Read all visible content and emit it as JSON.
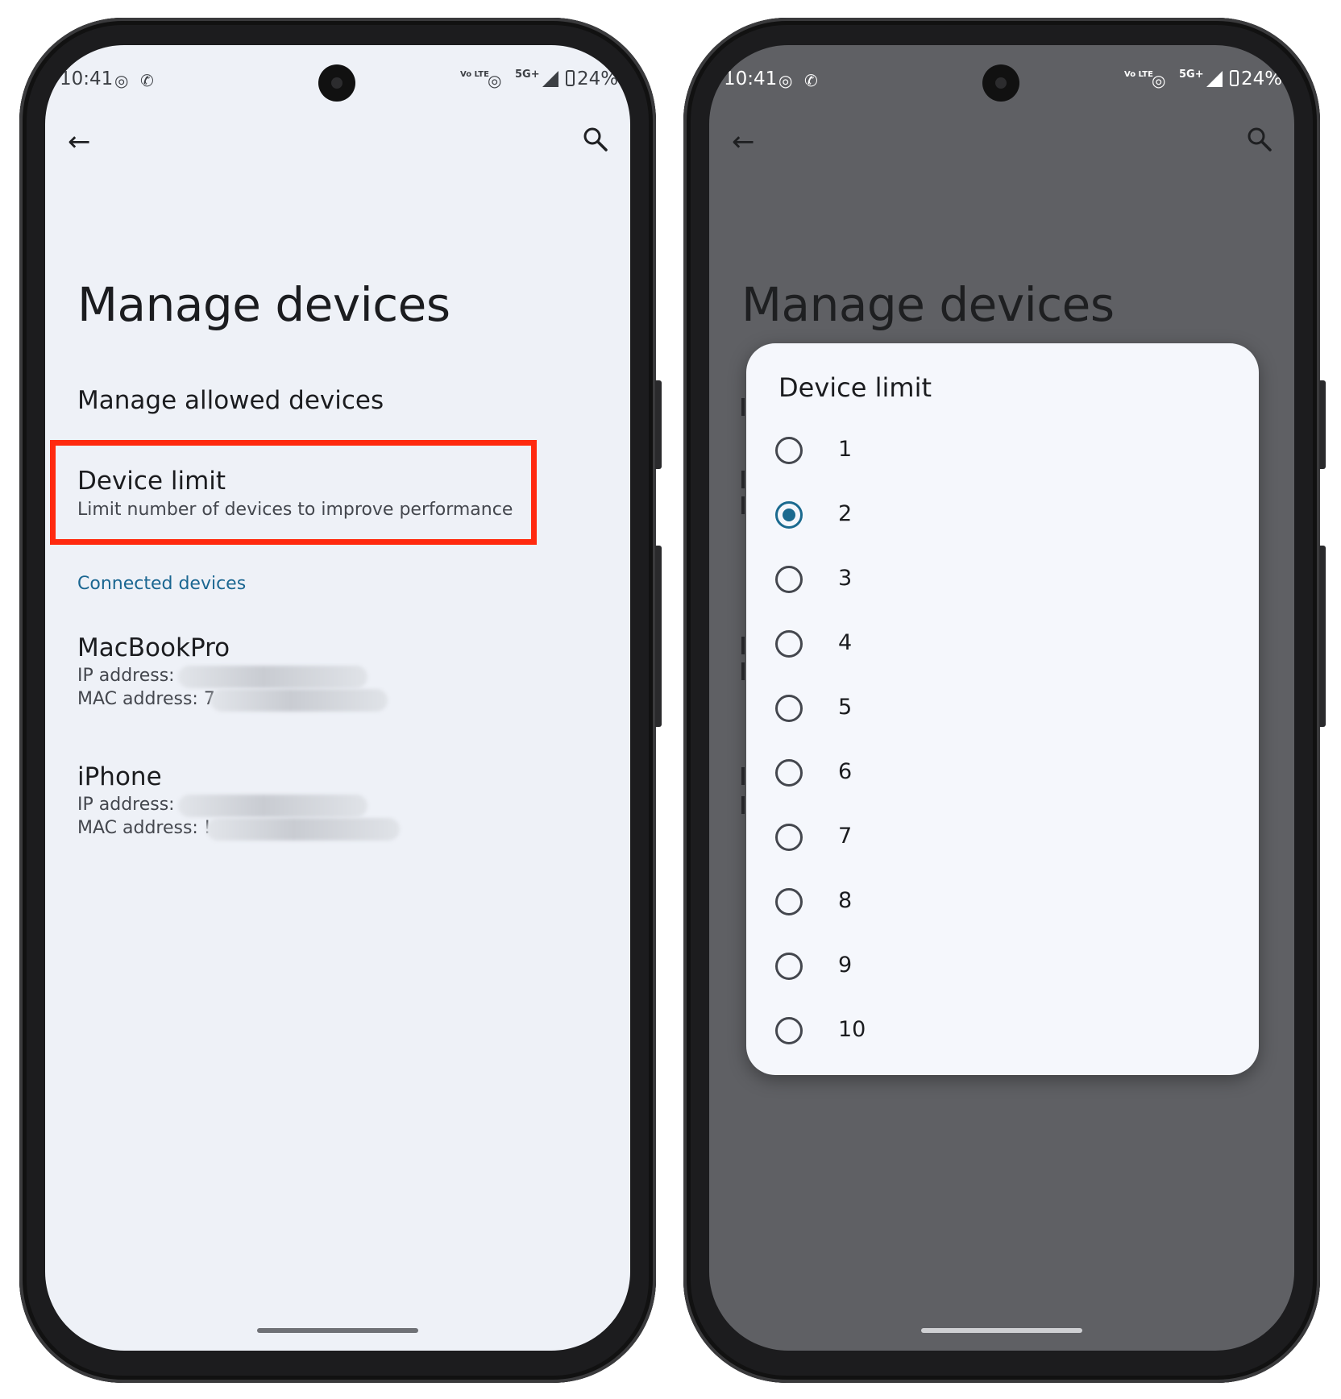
{
  "status": {
    "time": "10:41",
    "network": "5G+",
    "volte": "Vo LTE",
    "battery": "24%"
  },
  "left_screen": {
    "title": "Manage devices",
    "manage_allowed": "Manage allowed devices",
    "device_limit": {
      "title": "Device limit",
      "subtitle": "Limit number of devices to improve performance"
    },
    "section_header": "Connected devices",
    "devices": [
      {
        "name": "MacBookPro",
        "ip_label": "IP address:",
        "mac_label": "MAC address: 7"
      },
      {
        "name": "iPhone",
        "ip_label": "IP address:",
        "mac_label": "MAC address: !"
      }
    ]
  },
  "right_screen": {
    "title": "Manage devices",
    "dialog": {
      "title": "Device limit",
      "selected": "2",
      "options": [
        "1",
        "2",
        "3",
        "4",
        "5",
        "6",
        "7",
        "8",
        "9",
        "10"
      ]
    }
  },
  "colors": {
    "highlight": "#ff2a0f",
    "accent": "#1b6a8f",
    "scrim": "#5f6064"
  }
}
